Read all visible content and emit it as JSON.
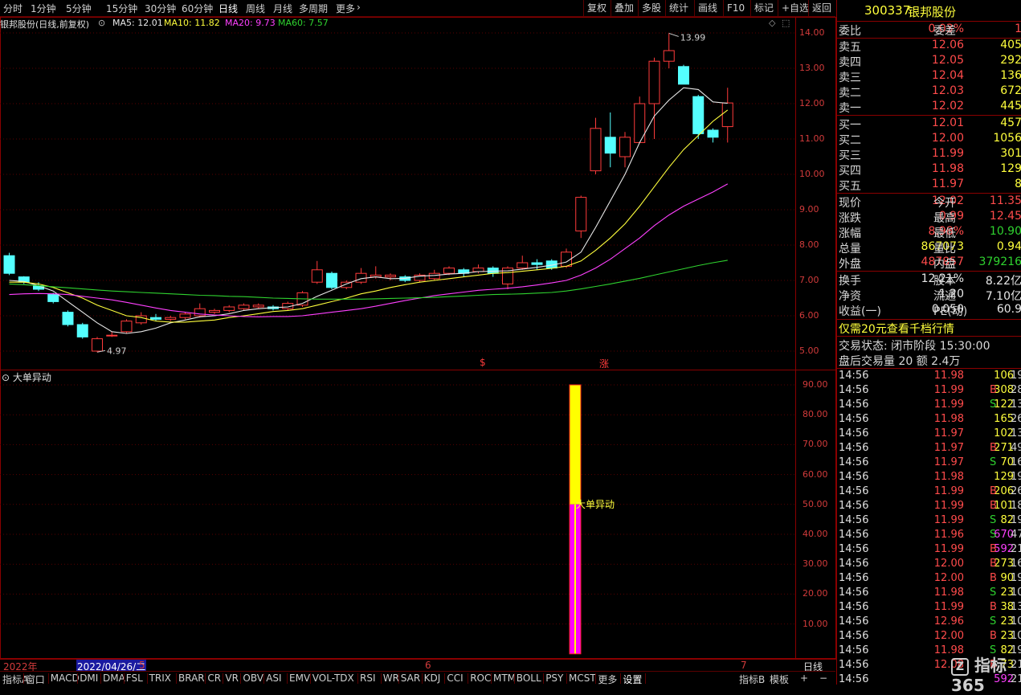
{
  "toolbar": {
    "periods": [
      "分时",
      "1分钟",
      "5分钟",
      "15分钟",
      "30分钟",
      "60分钟",
      "日线",
      "周线",
      "月线",
      "多周期",
      "更多"
    ],
    "active_period": "日线",
    "more_arrow": "›",
    "right_buttons": [
      "复权",
      "叠加",
      "多股",
      "统计",
      "画线",
      "F10",
      "标记",
      "+自选",
      "返回"
    ]
  },
  "main_chart": {
    "title": "银邦股份(日线,前复权)",
    "ma_labels": [
      {
        "text": "MA5: 12.01",
        "color": "#e8e8e8"
      },
      {
        "text": "MA10: 11.82",
        "color": "#ffff3c"
      },
      {
        "text": "MA20: 9.73",
        "color": "#ff40ff"
      },
      {
        "text": "MA60: 7.57",
        "color": "#2fd32f"
      }
    ],
    "y_axis": [
      "14.00",
      "13.00",
      "12.00",
      "11.00",
      "10.00",
      "9.00",
      "8.00",
      "7.00",
      "6.00",
      "5.00"
    ],
    "high_label": "13.99",
    "low_label": "4.97",
    "markers": [
      "$",
      "涨"
    ],
    "top_icons": [
      "◇",
      "⬚"
    ]
  },
  "sub_chart": {
    "title": "大单异动",
    "y_axis": [
      "90.00",
      "80.00",
      "70.00",
      "60.00",
      "50.00",
      "40.00",
      "30.00",
      "20.00",
      "10.00"
    ],
    "bar_label": "大单异动"
  },
  "time_axis": {
    "year_label": "2022年",
    "date_highlight": "2022/04/26/二",
    "tick_5": "5",
    "tick_6": "6",
    "tick_7": "7",
    "period_label": "日线"
  },
  "bottom_tabs": [
    "指标A",
    "窗口",
    "MACD",
    "DMI",
    "DMA",
    "FSL",
    "TRIX",
    "BRAR",
    "CR",
    "VR",
    "OBV",
    "ASI",
    "EMV",
    "VOL-TDX",
    "RSI",
    "WR",
    "SAR",
    "KDJ",
    "CCI",
    "ROC",
    "MTM",
    "BOLL",
    "PSY",
    "MCST",
    "更多",
    "设置"
  ],
  "bottom_right": [
    "指标B",
    "模板",
    "+",
    "−"
  ],
  "stock": {
    "code": "300337",
    "name": "银邦股份",
    "weibi_label": "委比",
    "weibi_value": "0.03%",
    "weicha_label": "委差",
    "weicha_value": "1",
    "asks": [
      {
        "label": "卖五",
        "price": "12.06",
        "vol": "405"
      },
      {
        "label": "卖四",
        "price": "12.05",
        "vol": "292"
      },
      {
        "label": "卖三",
        "price": "12.04",
        "vol": "136"
      },
      {
        "label": "卖二",
        "price": "12.03",
        "vol": "672"
      },
      {
        "label": "卖一",
        "price": "12.02",
        "vol": "445"
      }
    ],
    "bids": [
      {
        "label": "买一",
        "price": "12.01",
        "vol": "457"
      },
      {
        "label": "买二",
        "price": "12.00",
        "vol": "1056"
      },
      {
        "label": "买三",
        "price": "11.99",
        "vol": "301"
      },
      {
        "label": "买四",
        "price": "11.98",
        "vol": "129"
      },
      {
        "label": "买五",
        "price": "11.97",
        "vol": "8"
      }
    ],
    "quote": [
      {
        "l1": "现价",
        "v1": "12.02",
        "l2": "今开",
        "v2": "11.35",
        "c1": "red",
        "c2": "red"
      },
      {
        "l1": "涨跌",
        "v1": "0.99",
        "l2": "最高",
        "v2": "12.45",
        "c1": "red",
        "c2": "red"
      },
      {
        "l1": "涨幅",
        "v1": "8.98%",
        "l2": "最低",
        "v2": "10.90",
        "c1": "red",
        "c2": "green"
      },
      {
        "l1": "总量",
        "v1": "867073",
        "l2": "量比",
        "v2": "0.94",
        "c1": "yellow",
        "c2": "yellow"
      },
      {
        "l1": "外盘",
        "v1": "487857",
        "l2": "内盘",
        "v2": "379216",
        "c1": "red",
        "c2": "green"
      }
    ],
    "fund": [
      {
        "l1": "换手",
        "v1": "12.21%",
        "l2": "股本",
        "v2": "8.22亿"
      },
      {
        "l1": "净资",
        "v1": "1.20",
        "l2": "流通",
        "v2": "7.10亿"
      },
      {
        "l1": "收益(一)",
        "v1": "0.050",
        "l2": "PE(动)",
        "v2": "60.9"
      }
    ],
    "promo": "仅需20元查看千档行情",
    "trade_status": "交易状态: 闭市阶段 15:30:00",
    "after_hours": "盘后交易量 20 额 2.4万"
  },
  "ticks": [
    {
      "t": "14:56",
      "p": "11.98",
      "v": "106",
      "s": "",
      "n": "19",
      "pc": "red",
      "vc": "yellow"
    },
    {
      "t": "14:56",
      "p": "11.99",
      "v": "308",
      "s": "B",
      "n": "28",
      "pc": "red",
      "vc": "yellow"
    },
    {
      "t": "14:56",
      "p": "11.99",
      "v": "122",
      "s": "S",
      "n": "13",
      "pc": "red",
      "vc": "yellow"
    },
    {
      "t": "14:56",
      "p": "11.98",
      "v": "165",
      "s": "",
      "n": "26",
      "pc": "red",
      "vc": "yellow"
    },
    {
      "t": "14:56",
      "p": "11.97",
      "v": "102",
      "s": "",
      "n": "13",
      "pc": "red",
      "vc": "yellow"
    },
    {
      "t": "14:56",
      "p": "11.97",
      "v": "271",
      "s": "B",
      "n": "49",
      "pc": "red",
      "vc": "yellow"
    },
    {
      "t": "14:56",
      "p": "11.97",
      "v": "70",
      "s": "S",
      "n": "16",
      "pc": "red",
      "vc": "yellow"
    },
    {
      "t": "14:56",
      "p": "11.98",
      "v": "129",
      "s": "",
      "n": "19",
      "pc": "red",
      "vc": "yellow"
    },
    {
      "t": "14:56",
      "p": "11.99",
      "v": "206",
      "s": "B",
      "n": "26",
      "pc": "red",
      "vc": "yellow"
    },
    {
      "t": "14:56",
      "p": "11.99",
      "v": "101",
      "s": "B",
      "n": "18",
      "pc": "red",
      "vc": "yellow"
    },
    {
      "t": "14:56",
      "p": "11.99",
      "v": "82",
      "s": "S",
      "n": "19",
      "pc": "red",
      "vc": "yellow"
    },
    {
      "t": "14:56",
      "p": "11.96",
      "v": "670",
      "s": "S",
      "n": "47",
      "pc": "red",
      "vc": "mag"
    },
    {
      "t": "14:56",
      "p": "11.99",
      "v": "592",
      "s": "B",
      "n": "21",
      "pc": "red",
      "vc": "mag"
    },
    {
      "t": "14:56",
      "p": "12.00",
      "v": "273",
      "s": "B",
      "n": "16",
      "pc": "red",
      "vc": "yellow"
    },
    {
      "t": "14:56",
      "p": "12.00",
      "v": "90",
      "s": "B",
      "n": "19",
      "pc": "red",
      "vc": "yellow"
    },
    {
      "t": "14:56",
      "p": "11.98",
      "v": "23",
      "s": "S",
      "n": "10",
      "pc": "red",
      "vc": "yellow"
    },
    {
      "t": "14:56",
      "p": "11.99",
      "v": "38",
      "s": "B",
      "n": "13",
      "pc": "red",
      "vc": "yellow"
    },
    {
      "t": "14:56",
      "p": "12.96",
      "v": "23",
      "s": "S",
      "n": "10",
      "pc": "red",
      "vc": "yellow"
    },
    {
      "t": "14:56",
      "p": "12.00",
      "v": "23",
      "s": "B",
      "n": "10",
      "pc": "red",
      "vc": "yellow"
    },
    {
      "t": "14:56",
      "p": "11.98",
      "v": "82",
      "s": "S",
      "n": "19",
      "pc": "red",
      "vc": "yellow"
    },
    {
      "t": "14:56",
      "p": "12.08",
      "v": "73",
      "s": "B",
      "n": "21",
      "pc": "red",
      "vc": "yellow"
    },
    {
      "t": "14:56",
      "p": "",
      "v": "592",
      "s": "",
      "n": "21",
      "pc": "red",
      "vc": "mag"
    }
  ],
  "watermark": "指标365",
  "chart_data": {
    "type": "candlestick",
    "ylim": [
      4.6,
      14.4
    ],
    "candles": [
      [
        7.7,
        7.78,
        7.15,
        7.2
      ],
      [
        7.1,
        7.12,
        6.9,
        6.95
      ],
      [
        6.85,
        6.95,
        6.7,
        6.75
      ],
      [
        6.6,
        6.65,
        6.35,
        6.4
      ],
      [
        6.1,
        6.15,
        5.7,
        5.75
      ],
      [
        5.75,
        5.8,
        5.35,
        5.4
      ],
      [
        5.0,
        5.4,
        4.97,
        5.35
      ],
      [
        5.45,
        5.55,
        5.4,
        5.45
      ],
      [
        5.55,
        5.9,
        5.5,
        5.85
      ],
      [
        5.8,
        6.1,
        5.75,
        6.0
      ],
      [
        5.95,
        6.05,
        5.85,
        5.9
      ],
      [
        5.9,
        6.0,
        5.85,
        5.95
      ],
      [
        5.95,
        6.1,
        5.9,
        6.05
      ],
      [
        6.0,
        6.35,
        5.95,
        6.2
      ],
      [
        6.1,
        6.2,
        6.05,
        6.15
      ],
      [
        6.15,
        6.3,
        6.1,
        6.25
      ],
      [
        6.2,
        6.35,
        6.15,
        6.3
      ],
      [
        6.25,
        6.35,
        6.2,
        6.3
      ],
      [
        6.25,
        6.3,
        6.15,
        6.2
      ],
      [
        6.2,
        6.4,
        6.15,
        6.35
      ],
      [
        6.3,
        6.7,
        6.25,
        6.65
      ],
      [
        6.95,
        7.55,
        6.9,
        7.3
      ],
      [
        7.2,
        7.25,
        6.75,
        6.8
      ],
      [
        6.8,
        7.0,
        6.75,
        6.95
      ],
      [
        6.95,
        7.35,
        6.9,
        7.2
      ],
      [
        7.1,
        7.4,
        7.05,
        7.15
      ],
      [
        7.1,
        7.2,
        7.0,
        7.15
      ],
      [
        7.1,
        7.15,
        6.95,
        7.0
      ],
      [
        7.0,
        7.2,
        6.95,
        7.15
      ],
      [
        7.05,
        7.3,
        7.0,
        7.2
      ],
      [
        7.2,
        7.4,
        7.15,
        7.35
      ],
      [
        7.3,
        7.35,
        7.1,
        7.2
      ],
      [
        7.25,
        7.45,
        7.2,
        7.35
      ],
      [
        7.35,
        7.4,
        7.1,
        7.2
      ],
      [
        6.9,
        7.4,
        6.75,
        7.35
      ],
      [
        7.35,
        7.7,
        7.3,
        7.5
      ],
      [
        7.5,
        7.6,
        7.3,
        7.45
      ],
      [
        7.55,
        7.6,
        7.3,
        7.35
      ],
      [
        7.4,
        7.9,
        7.35,
        7.8
      ],
      [
        8.4,
        9.4,
        8.2,
        9.35
      ],
      [
        10.1,
        11.6,
        10.0,
        11.3
      ],
      [
        11.05,
        11.75,
        10.2,
        10.6
      ],
      [
        10.5,
        11.2,
        10.2,
        11.05
      ],
      [
        10.9,
        12.2,
        10.9,
        12.0
      ],
      [
        12.0,
        13.3,
        11.0,
        13.2
      ],
      [
        13.2,
        13.99,
        13.0,
        13.5
      ],
      [
        13.05,
        13.1,
        12.65,
        12.55
      ],
      [
        12.2,
        12.25,
        11.0,
        11.15
      ],
      [
        11.25,
        11.3,
        10.9,
        11.05
      ],
      [
        11.35,
        12.45,
        10.9,
        12.02
      ]
    ],
    "series": [
      {
        "name": "MA5",
        "color": "#e8e8e8",
        "values": [
          7.0,
          6.97,
          6.85,
          6.7,
          6.4,
          6.1,
          5.8,
          5.55,
          5.5,
          5.55,
          5.65,
          5.8,
          5.88,
          5.97,
          6.0,
          6.06,
          6.15,
          6.2,
          6.23,
          6.25,
          6.35,
          6.55,
          6.72,
          6.9,
          7.05,
          7.1,
          7.05,
          7.06,
          7.12,
          7.14,
          7.18,
          7.2,
          7.25,
          7.26,
          7.27,
          7.32,
          7.37,
          7.43,
          7.52,
          7.8,
          8.5,
          9.25,
          10.0,
          10.9,
          11.65,
          12.1,
          12.45,
          12.4,
          12.05,
          12.01
        ]
      },
      {
        "name": "MA10",
        "color": "#ffff3c",
        "values": [
          6.95,
          6.95,
          6.9,
          6.8,
          6.65,
          6.5,
          6.3,
          6.15,
          6.0,
          5.95,
          5.85,
          5.82,
          5.82,
          5.85,
          5.88,
          5.95,
          6.0,
          6.06,
          6.12,
          6.15,
          6.2,
          6.3,
          6.4,
          6.5,
          6.62,
          6.7,
          6.8,
          6.88,
          6.95,
          7.0,
          7.05,
          7.1,
          7.15,
          7.2,
          7.22,
          7.26,
          7.3,
          7.34,
          7.4,
          7.55,
          7.85,
          8.2,
          8.6,
          9.1,
          9.65,
          10.2,
          10.7,
          11.1,
          11.5,
          11.82
        ]
      },
      {
        "name": "MA20",
        "color": "#ff40ff",
        "values": [
          6.6,
          6.62,
          6.63,
          6.62,
          6.6,
          6.55,
          6.5,
          6.45,
          6.38,
          6.3,
          6.22,
          6.15,
          6.1,
          6.05,
          6.02,
          6.0,
          5.98,
          5.97,
          5.98,
          5.98,
          6.0,
          6.05,
          6.1,
          6.15,
          6.2,
          6.27,
          6.35,
          6.43,
          6.5,
          6.57,
          6.62,
          6.67,
          6.72,
          6.75,
          6.78,
          6.82,
          6.87,
          6.93,
          7.0,
          7.15,
          7.35,
          7.6,
          7.9,
          8.2,
          8.55,
          8.85,
          9.1,
          9.3,
          9.5,
          9.73
        ]
      },
      {
        "name": "MA60",
        "color": "#2fd32f",
        "values": [
          6.9,
          6.88,
          6.85,
          6.82,
          6.79,
          6.76,
          6.73,
          6.7,
          6.68,
          6.66,
          6.64,
          6.62,
          6.6,
          6.58,
          6.57,
          6.55,
          6.54,
          6.52,
          6.5,
          6.49,
          6.48,
          6.47,
          6.47,
          6.47,
          6.47,
          6.48,
          6.49,
          6.5,
          6.51,
          6.52,
          6.54,
          6.56,
          6.58,
          6.6,
          6.61,
          6.62,
          6.64,
          6.66,
          6.7,
          6.76,
          6.83,
          6.9,
          6.98,
          7.06,
          7.15,
          7.24,
          7.33,
          7.42,
          7.5,
          7.57
        ]
      }
    ],
    "sub_bar": {
      "index": 39,
      "total": 90,
      "split": 50
    }
  }
}
